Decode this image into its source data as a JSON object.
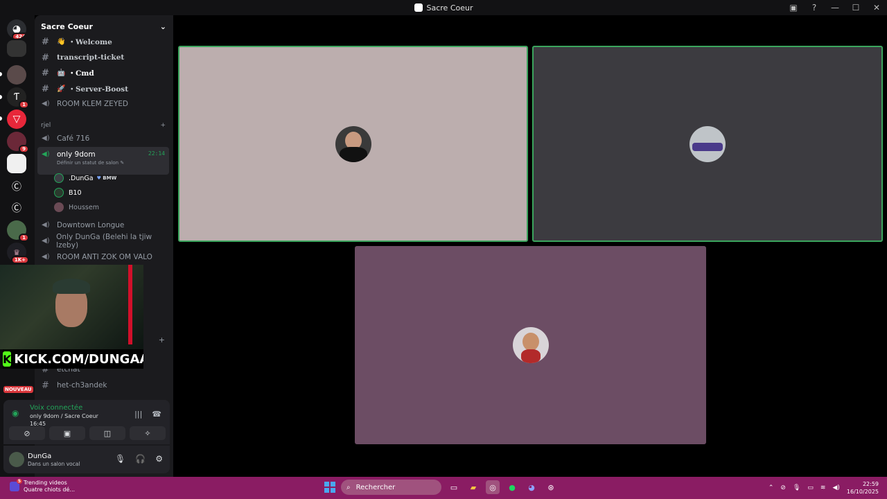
{
  "window": {
    "title": "Sacre Coeur",
    "ctrl_min": "—",
    "ctrl_max": "☐",
    "ctrl_close": "✕",
    "inbox_icon": "inbox-icon",
    "help_icon": "help-icon"
  },
  "servers": [
    {
      "badge": "424"
    },
    {
      "badge": ""
    },
    {
      "badge": ""
    },
    {
      "badge": "1"
    },
    {
      "badge": ""
    },
    {
      "badge": "9"
    },
    {
      "badge": ""
    },
    {
      "badge": ""
    },
    {
      "badge": ""
    },
    {
      "badge": "1"
    },
    {
      "badge": "1K+"
    }
  ],
  "nouveau_label": "NOUVEAU",
  "sidebar": {
    "server_name": "Sacre Coeur",
    "channels_top": [
      {
        "type": "text",
        "emoji": "👋",
        "label": "・Welcome"
      },
      {
        "type": "text",
        "emoji": "",
        "label": "transcript-ticket"
      },
      {
        "type": "text",
        "emoji": "🤖",
        "label": "・Cmd"
      },
      {
        "type": "text",
        "emoji": "🚀",
        "label": "・Server-Boost"
      },
      {
        "type": "voice",
        "emoji": "",
        "label": "ROOM KLEM ZEYED"
      }
    ],
    "category": "rjel",
    "voice_channels": [
      {
        "label": "Café 716"
      }
    ],
    "active_channel": {
      "label": "only 9dom",
      "time": "22:14",
      "status": "Définir un statut de salon"
    },
    "members": [
      {
        "name": ".DunGa",
        "tag": "BMW"
      },
      {
        "name": "B10",
        "tag": ""
      },
      {
        "name": "Houssem",
        "tag": ""
      }
    ],
    "more_channels": [
      {
        "label": "Downtown Longue"
      },
      {
        "label": "Only DunGa (Belehi la tjiw lzeby)"
      },
      {
        "label": "ROOM ANTI ZOK OM VALO"
      }
    ],
    "bottom_channels": [
      {
        "label": "etchat"
      },
      {
        "label": "het-ch3andek"
      }
    ]
  },
  "webcam": {
    "overlay_text": "KICK.COM/DUNGAA"
  },
  "voice_panel": {
    "status": "Voix connectée",
    "location": "only 9dom / Sacre Coeur",
    "time": "16:45"
  },
  "user_panel": {
    "name": "DunGa",
    "status": "Dans un salon vocal"
  },
  "tiles": [
    {
      "bg": "#bcaeae",
      "border": "#3ba55d"
    },
    {
      "bg": "#3c3b40",
      "border": "#3ba55d"
    },
    {
      "bg": "#6c4d64",
      "border": "#6c4d64"
    }
  ],
  "taskbar": {
    "news_title": "Trending videos",
    "news_sub": "Quatre chiots dé...",
    "news_badge": "5",
    "search_placeholder": "Rechercher",
    "time": "22:59",
    "date": "16/10/2025"
  }
}
